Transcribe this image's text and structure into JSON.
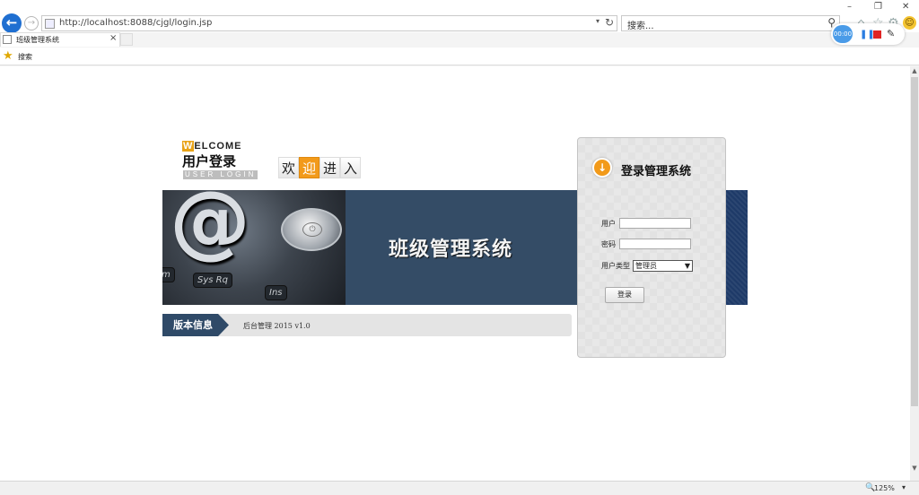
{
  "browser": {
    "url": "http://localhost:8088/cjgl/login.jsp",
    "search_placeholder": "搜索...",
    "tab_title": "班级管理系统",
    "tab_close": "×",
    "favorites_item": "搜索",
    "zoom": "125%",
    "rec_timer": "00:00",
    "window_controls": {
      "minimize": "–",
      "maximize": "❐",
      "close": "✕"
    }
  },
  "logo": {
    "welcome_initial": "W",
    "welcome_rest": "ELCOME",
    "title_cn": "用户登录",
    "title_en": "USER LOGIN",
    "welcome_chars": [
      "欢",
      "迎",
      "进",
      "入"
    ]
  },
  "banner": {
    "title": "班级管理系统",
    "keys": [
      "Sys Rq",
      "Ins",
      "m"
    ]
  },
  "version": {
    "label": "版本信息",
    "text": "后台管理 2015 v1.0"
  },
  "login": {
    "title": "登录管理系统",
    "username_label": "用户",
    "username_value": "",
    "password_label": "密码",
    "password_value": "",
    "usertype_label": "用户类型",
    "usertype_selected": "管理员",
    "submit_label": "登录"
  },
  "colors": {
    "accent": "#f29a1a",
    "banner_blue": "#344c66",
    "browser_blue": "#1f6fd1"
  }
}
